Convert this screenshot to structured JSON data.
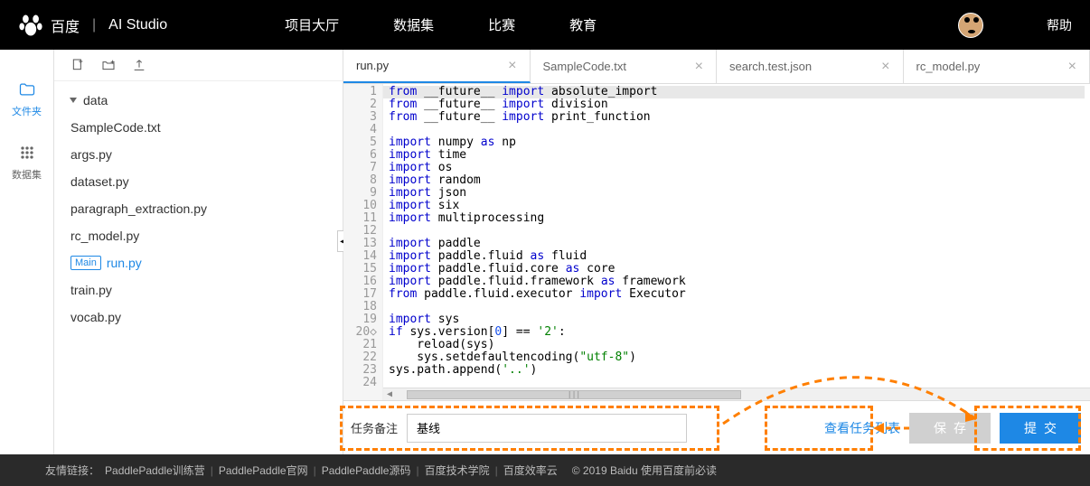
{
  "header": {
    "logo_text": "百度",
    "studio_text": "AI Studio",
    "nav": [
      "项目大厅",
      "数据集",
      "比赛",
      "教育"
    ],
    "help": "帮助"
  },
  "left_rail": {
    "files": "文件夹",
    "datasets": "数据集"
  },
  "file_tree": {
    "folder": "data",
    "files": [
      "SampleCode.txt",
      "args.py",
      "dataset.py",
      "paragraph_extraction.py",
      "rc_model.py"
    ],
    "main_badge": "Main",
    "main_file": "run.py",
    "rest": [
      "train.py",
      "vocab.py"
    ]
  },
  "tabs": [
    "run.py",
    "SampleCode.txt",
    "search.test.json",
    "rc_model.py"
  ],
  "code_lines": [
    {
      "n": 1,
      "seg": [
        [
          "from",
          "blue"
        ],
        [
          " __future__ ",
          "op"
        ],
        [
          "import",
          "blue"
        ],
        [
          " absolute_import",
          "op"
        ]
      ]
    },
    {
      "n": 2,
      "seg": [
        [
          "from",
          "blue"
        ],
        [
          " __future__ ",
          "op"
        ],
        [
          "import",
          "blue"
        ],
        [
          " division",
          "op"
        ]
      ]
    },
    {
      "n": 3,
      "seg": [
        [
          "from",
          "blue"
        ],
        [
          " __future__ ",
          "op"
        ],
        [
          "import",
          "blue"
        ],
        [
          " print_function",
          "op"
        ]
      ]
    },
    {
      "n": 4,
      "seg": []
    },
    {
      "n": 5,
      "seg": [
        [
          "import",
          "blue"
        ],
        [
          " numpy ",
          "op"
        ],
        [
          "as",
          "blue"
        ],
        [
          " np",
          "op"
        ]
      ]
    },
    {
      "n": 6,
      "seg": [
        [
          "import",
          "blue"
        ],
        [
          " time",
          "op"
        ]
      ]
    },
    {
      "n": 7,
      "seg": [
        [
          "import",
          "blue"
        ],
        [
          " os",
          "op"
        ]
      ]
    },
    {
      "n": 8,
      "seg": [
        [
          "import",
          "blue"
        ],
        [
          " random",
          "op"
        ]
      ]
    },
    {
      "n": 9,
      "seg": [
        [
          "import",
          "blue"
        ],
        [
          " json",
          "op"
        ]
      ]
    },
    {
      "n": 10,
      "seg": [
        [
          "import",
          "blue"
        ],
        [
          " six",
          "op"
        ]
      ]
    },
    {
      "n": 11,
      "seg": [
        [
          "import",
          "blue"
        ],
        [
          " multiprocessing",
          "op"
        ]
      ]
    },
    {
      "n": 12,
      "seg": []
    },
    {
      "n": 13,
      "seg": [
        [
          "import",
          "blue"
        ],
        [
          " paddle",
          "op"
        ]
      ]
    },
    {
      "n": 14,
      "seg": [
        [
          "import",
          "blue"
        ],
        [
          " paddle.fluid ",
          "op"
        ],
        [
          "as",
          "blue"
        ],
        [
          " fluid",
          "op"
        ]
      ]
    },
    {
      "n": 15,
      "seg": [
        [
          "import",
          "blue"
        ],
        [
          " paddle.fluid.core ",
          "op"
        ],
        [
          "as",
          "blue"
        ],
        [
          " core",
          "op"
        ]
      ]
    },
    {
      "n": 16,
      "seg": [
        [
          "import",
          "blue"
        ],
        [
          " paddle.fluid.framework ",
          "op"
        ],
        [
          "as",
          "blue"
        ],
        [
          " framework",
          "op"
        ]
      ]
    },
    {
      "n": 17,
      "seg": [
        [
          "from",
          "blue"
        ],
        [
          " paddle.fluid.executor ",
          "op"
        ],
        [
          "import",
          "blue"
        ],
        [
          " Executor",
          "op"
        ]
      ]
    },
    {
      "n": 18,
      "seg": []
    },
    {
      "n": 19,
      "seg": [
        [
          "import",
          "blue"
        ],
        [
          " sys",
          "op"
        ]
      ]
    },
    {
      "n": 20,
      "seg": [
        [
          "if",
          "blue"
        ],
        [
          " sys.version[",
          "op"
        ],
        [
          "0",
          "num"
        ],
        [
          "] == ",
          "op"
        ],
        [
          "'2'",
          "str"
        ],
        [
          ":",
          "op"
        ]
      ],
      "diamond": true
    },
    {
      "n": 21,
      "seg": [
        [
          "    reload(sys)",
          "op"
        ]
      ]
    },
    {
      "n": 22,
      "seg": [
        [
          "    sys.setdefaultencoding(",
          "op"
        ],
        [
          "\"utf-8\"",
          "str"
        ],
        [
          ")",
          "op"
        ]
      ]
    },
    {
      "n": 23,
      "seg": [
        [
          "sys.path.append(",
          "op"
        ],
        [
          "'..'",
          "str"
        ],
        [
          ")",
          "op"
        ]
      ]
    },
    {
      "n": 24,
      "seg": []
    }
  ],
  "bottom": {
    "task_label": "任务备注",
    "task_value": "基线",
    "view_list": "查看任务列表",
    "save": "保存",
    "submit": "提交"
  },
  "footer": {
    "label": "友情链接：",
    "links": [
      "PaddlePaddle训练营",
      "PaddlePaddle官网",
      "PaddlePaddle源码",
      "百度技术学院",
      "百度效率云"
    ],
    "copyright": "© 2019 Baidu 使用百度前必读"
  }
}
